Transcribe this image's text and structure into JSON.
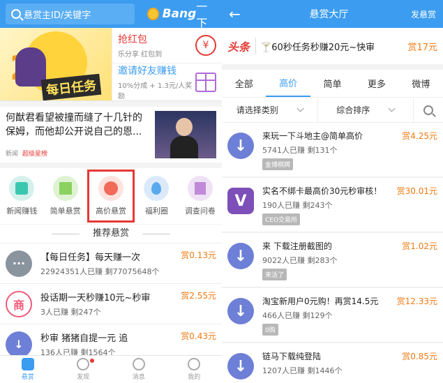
{
  "left": {
    "search_placeholder": "悬赏主ID/关键字",
    "brand_en": "Bang",
    "brand_cn": "一下",
    "banner_image_text": "每日任务",
    "banner_rows": [
      {
        "title": "抢红包",
        "sub": "乐分享 红包到",
        "icon_text": "¥"
      },
      {
        "title": "邀请好友赚钱",
        "sub": "10%分成 + 1.3元/人奖励"
      }
    ],
    "news": {
      "title": "何猷君看望被撞而缝了十几针的保姆，而他却公开说自己的恩...",
      "source": "新闻",
      "tag": "超级星榜"
    },
    "icons": [
      {
        "label": "新闻赚钱"
      },
      {
        "label": "简单悬赏"
      },
      {
        "label": "高价悬赏"
      },
      {
        "label": "福利圈"
      },
      {
        "label": "调查问卷"
      }
    ],
    "recommend_title": "推荐悬赏",
    "tasks": [
      {
        "title": "【每日任务】每天赚一次",
        "stats": "22924351人已赚 剩77075648个",
        "reward": "赏0.13元",
        "avatar_text": "···"
      },
      {
        "title": "投话期一天秒赚10元~秒审",
        "stats": "3人已赚 剩247个",
        "reward": "赏2.55元",
        "avatar_text": "商"
      },
      {
        "title": "秒审 猪猪自提一元 追",
        "stats": "136人已赚 剩1564个",
        "reward": "赏0.43元",
        "avatar_text": "↓"
      }
    ],
    "tabs": [
      {
        "label": "悬赏"
      },
      {
        "label": "发现"
      },
      {
        "label": "消息"
      },
      {
        "label": "我的"
      }
    ]
  },
  "right": {
    "back": "←",
    "title": "悬赏大厅",
    "publish": "发悬赏",
    "promo": {
      "logo": "头条",
      "text": "🍸60秒任务秒赚20元~快审",
      "reward": "赏17元"
    },
    "tabs": [
      "全部",
      "高价",
      "简单",
      "更多",
      "微博"
    ],
    "filters": [
      "请选择类别",
      "综合排序"
    ],
    "tasks": [
      {
        "title": "来玩一下斗地主@简单高价",
        "stats": "5741人已赚 剩131个",
        "tag": "金博棋牌",
        "reward": "赏4.25元",
        "avatar_text": "↓"
      },
      {
        "title": "实名不绑卡最高价30元秒审核！",
        "stats": "190人已赚 剩243个",
        "tag": "CEO交易所",
        "reward": "赏30.01元",
        "avatar_text": "V"
      },
      {
        "title": "来 下载注册截图的",
        "stats": "9022人已赚 剩283个",
        "tag": "来活了",
        "reward": "赏1.02元",
        "avatar_text": "↓"
      },
      {
        "title": "淘宝新用户0元购！再赏14.5元",
        "stats": "466人已赚 剩129个",
        "tag": "0购",
        "reward": "赏12.33元",
        "avatar_text": "↓"
      },
      {
        "title": "链马下载纯登陆",
        "stats": "1207人已赚 剩1446个",
        "tag": "",
        "reward": "赏0.85元",
        "avatar_text": "↓"
      }
    ]
  }
}
